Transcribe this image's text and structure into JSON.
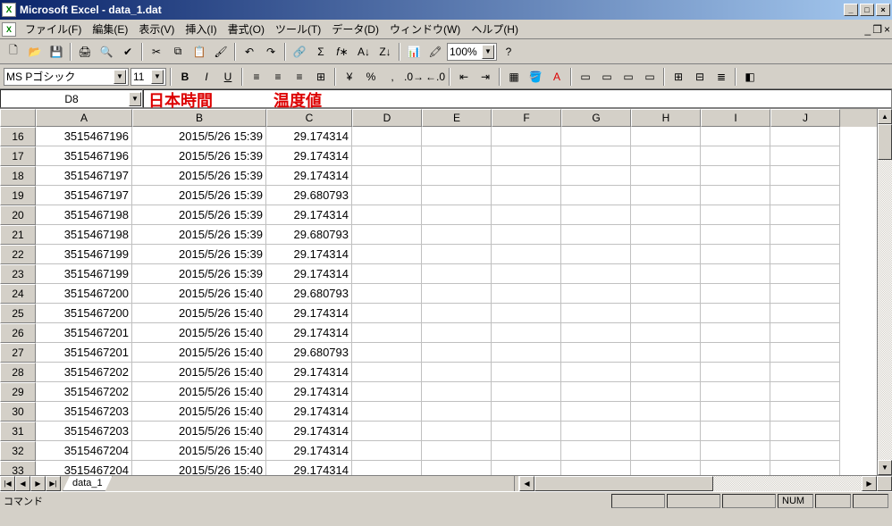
{
  "title": "Microsoft Excel - data_1.dat",
  "menus": {
    "file": "ファイル(F)",
    "edit": "編集(E)",
    "view": "表示(V)",
    "insert": "挿入(I)",
    "format": "書式(O)",
    "tools": "ツール(T)",
    "data": "データ(D)",
    "window": "ウィンドウ(W)",
    "help": "ヘルプ(H)"
  },
  "font": {
    "name": "MS Pゴシック",
    "size": "11"
  },
  "zoom": "100%",
  "nameBox": "D8",
  "overlays": {
    "col_b": "日本時間",
    "col_c": "温度値"
  },
  "columns": [
    "A",
    "B",
    "C",
    "D",
    "E",
    "F",
    "G",
    "H",
    "I",
    "J"
  ],
  "rowStart": 16,
  "rows": [
    {
      "n": 16,
      "a": "3515467196",
      "b": "2015/5/26 15:39",
      "c": "29.174314"
    },
    {
      "n": 17,
      "a": "3515467196",
      "b": "2015/5/26 15:39",
      "c": "29.174314"
    },
    {
      "n": 18,
      "a": "3515467197",
      "b": "2015/5/26 15:39",
      "c": "29.174314"
    },
    {
      "n": 19,
      "a": "3515467197",
      "b": "2015/5/26 15:39",
      "c": "29.680793"
    },
    {
      "n": 20,
      "a": "3515467198",
      "b": "2015/5/26 15:39",
      "c": "29.174314"
    },
    {
      "n": 21,
      "a": "3515467198",
      "b": "2015/5/26 15:39",
      "c": "29.680793"
    },
    {
      "n": 22,
      "a": "3515467199",
      "b": "2015/5/26 15:39",
      "c": "29.174314"
    },
    {
      "n": 23,
      "a": "3515467199",
      "b": "2015/5/26 15:39",
      "c": "29.174314"
    },
    {
      "n": 24,
      "a": "3515467200",
      "b": "2015/5/26 15:40",
      "c": "29.680793"
    },
    {
      "n": 25,
      "a": "3515467200",
      "b": "2015/5/26 15:40",
      "c": "29.174314"
    },
    {
      "n": 26,
      "a": "3515467201",
      "b": "2015/5/26 15:40",
      "c": "29.174314"
    },
    {
      "n": 27,
      "a": "3515467201",
      "b": "2015/5/26 15:40",
      "c": "29.680793"
    },
    {
      "n": 28,
      "a": "3515467202",
      "b": "2015/5/26 15:40",
      "c": "29.174314"
    },
    {
      "n": 29,
      "a": "3515467202",
      "b": "2015/5/26 15:40",
      "c": "29.174314"
    },
    {
      "n": 30,
      "a": "3515467203",
      "b": "2015/5/26 15:40",
      "c": "29.174314"
    },
    {
      "n": 31,
      "a": "3515467203",
      "b": "2015/5/26 15:40",
      "c": "29.174314"
    },
    {
      "n": 32,
      "a": "3515467204",
      "b": "2015/5/26 15:40",
      "c": "29.174314"
    },
    {
      "n": 33,
      "a": "3515467204",
      "b": "2015/5/26 15:40",
      "c": "29.174314"
    }
  ],
  "sheetTab": "data_1",
  "status": {
    "ready": "コマンド",
    "num": "NUM"
  }
}
